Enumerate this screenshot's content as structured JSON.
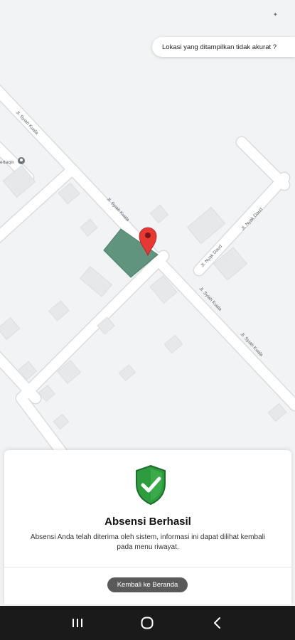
{
  "banner": {
    "text": "Lokasi yang ditampilkan tidak akurat ?"
  },
  "map": {
    "streets": {
      "syiah_kuala_1": "Jl. Syiah Kuala",
      "syiah_kuala_2": "Jl. Syiah Kuala",
      "syiah_kuala_3": "Jl. Syiah Kuala",
      "syiah_kuala_4": "Jl. Syiah Kuala",
      "nyak_daud_1": "Jl. Nyak Daud",
      "nyak_daud_2": "Jl. Nyak Daud"
    },
    "poi_label": "ertaqin",
    "geofence_color": "#5a8f78",
    "pin_color": "#e53935"
  },
  "sheet": {
    "title": "Absensi Berhasil",
    "message": "Absensi Anda telah diterima oleh sistem, informasi ini dapat dilihat kembali pada menu riwayat.",
    "button_label": "Kembali ke Beranda",
    "shield_color": "#2e9b3e"
  },
  "navbar": {
    "icons": [
      "recent-apps-icon",
      "home-icon",
      "back-icon"
    ]
  }
}
